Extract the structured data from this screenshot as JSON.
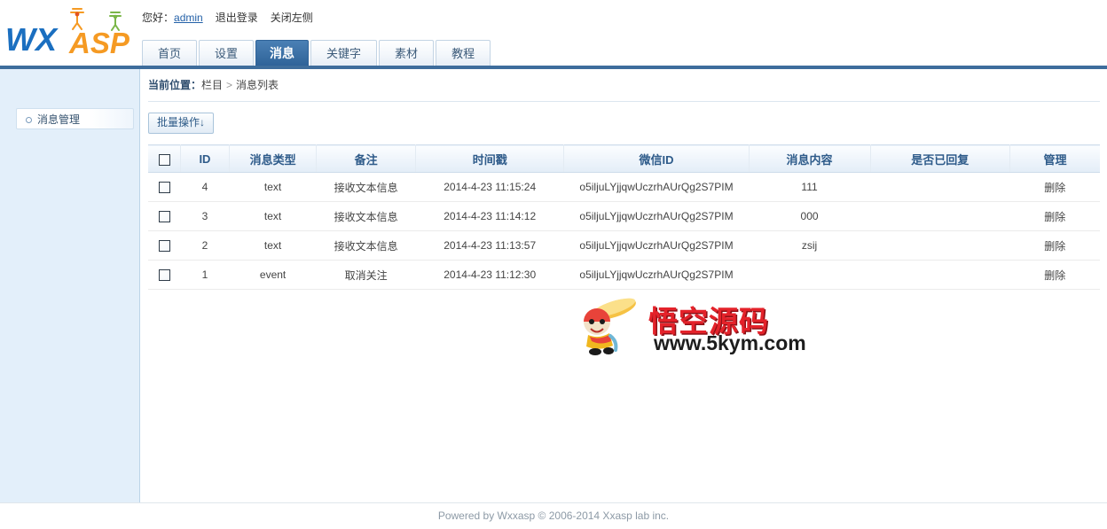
{
  "brand": {
    "logo_primary": "WX",
    "logo_secondary": "ASP",
    "color_primary": "#1b6fc0",
    "color_secondary": "#f59a23"
  },
  "userbar": {
    "greeting": "您好：",
    "username": "admin",
    "logout": "退出登录",
    "toggle_sidebar": "关闭左侧"
  },
  "tabs": [
    {
      "label": "首页",
      "active": false
    },
    {
      "label": "设置",
      "active": false
    },
    {
      "label": "消息",
      "active": true
    },
    {
      "label": "关键字",
      "active": false
    },
    {
      "label": "素材",
      "active": false
    },
    {
      "label": "教程",
      "active": false
    }
  ],
  "sidebar": {
    "items": [
      {
        "label": "消息管理",
        "bullet": "circle-bullet-icon"
      }
    ]
  },
  "breadcrumb": {
    "label": "当前位置：",
    "root": "栏目",
    "separator": ">",
    "current": "消息列表"
  },
  "toolbar": {
    "batch_label": "批量操作↓"
  },
  "table": {
    "select_all_name": "select-all-checkbox",
    "columns": [
      {
        "key": "checkbox",
        "label": ""
      },
      {
        "key": "id",
        "label": "ID"
      },
      {
        "key": "type",
        "label": "消息类型"
      },
      {
        "key": "note",
        "label": "备注"
      },
      {
        "key": "timestamp",
        "label": "时间戳"
      },
      {
        "key": "wechat_id",
        "label": "微信ID"
      },
      {
        "key": "content",
        "label": "消息内容"
      },
      {
        "key": "replied",
        "label": "是否已回复"
      },
      {
        "key": "manage",
        "label": "管理"
      }
    ],
    "rows": [
      {
        "id": "4",
        "type": "text",
        "note": "接收文本信息",
        "timestamp": "2014-4-23 11:15:24",
        "wechat_id": "o5iljuLYjjqwUczrhAUrQg2S7PIM",
        "content": "111",
        "replied": "",
        "manage": "删除"
      },
      {
        "id": "3",
        "type": "text",
        "note": "接收文本信息",
        "timestamp": "2014-4-23 11:14:12",
        "wechat_id": "o5iljuLYjjqwUczrhAUrQg2S7PIM",
        "content": "000",
        "replied": "",
        "manage": "删除"
      },
      {
        "id": "2",
        "type": "text",
        "note": "接收文本信息",
        "timestamp": "2014-4-23 11:13:57",
        "wechat_id": "o5iljuLYjjqwUczrhAUrQg2S7PIM",
        "content": "zsij",
        "replied": "",
        "manage": "删除"
      },
      {
        "id": "1",
        "type": "event",
        "note": "取消关注",
        "timestamp": "2014-4-23 11:12:30",
        "wechat_id": "o5iljuLYjjqwUczrhAUrQg2S7PIM",
        "content": "",
        "replied": "",
        "manage": "删除"
      }
    ]
  },
  "watermark": {
    "text": "悟空源码",
    "url": "www.5kym.com",
    "color": "#e4222a"
  },
  "footer": {
    "text": "Powered by Wxxasp © 2006-2014 Xxasp lab inc."
  }
}
